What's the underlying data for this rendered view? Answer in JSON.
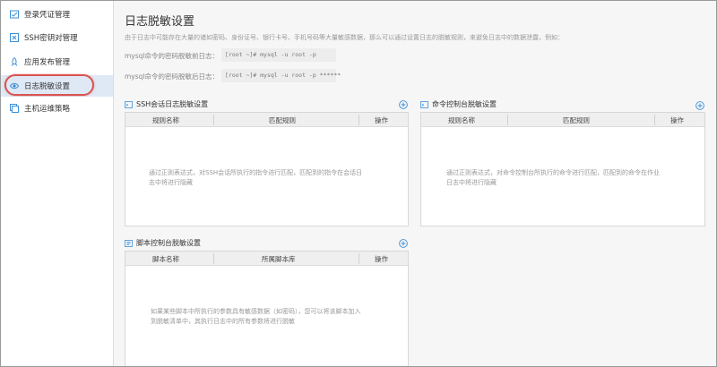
{
  "sidebar": {
    "items": [
      {
        "label": "登录凭证管理",
        "icon": "credential-icon"
      },
      {
        "label": "SSH密钥对管理",
        "icon": "key-pair-icon"
      },
      {
        "label": "应用发布管理",
        "icon": "rocket-icon"
      },
      {
        "label": "日志脱敏设置",
        "icon": "eye-icon"
      },
      {
        "label": "主机运维策略",
        "icon": "policy-icon"
      }
    ]
  },
  "main": {
    "title": "日志脱敏设置",
    "description": "由于日志中可能存在大量的诸如密码、身份证号、银行卡号、手机号码等大量敏感数据，那么可以通过设置日志的脱敏规则，来避免日志中的数据泄露，例如：",
    "examples": [
      {
        "label": "mysql命令的密码脱敏前日志：",
        "code": "[root ~]# mysql -u root -p"
      },
      {
        "label": "mysql命令的密码脱敏后日志：",
        "code": "[root ~]# mysql -u root -p ******"
      }
    ]
  },
  "panels": {
    "ssh": {
      "title": "SSH会话日志脱敏设置",
      "columns": [
        "规则名称",
        "匹配规则",
        "操作"
      ],
      "empty_line1": "通过正则表达式，对SSH会话所执行的指令进行匹配，匹配到的指令在会话日",
      "empty_line2": "志中将进行隐藏"
    },
    "console": {
      "title": "命令控制台脱敏设置",
      "columns": [
        "规则名称",
        "匹配规则",
        "操作"
      ],
      "empty_line1": "通过正则表达式，对命令控制台所执行的命令进行匹配，匹配到的命令在作业",
      "empty_line2": "日志中将进行隐藏"
    },
    "script": {
      "title": "脚本控制台脱敏设置",
      "columns": [
        "脚本名称",
        "所属脚本库",
        "操作"
      ],
      "empty_line1": "如果某些脚本中所执行的参数具有敏感数据（如密码），您可以将该脚本加入",
      "empty_line2": "到脱敏清单中，其执行日志中的所有参数将进行脱敏"
    }
  },
  "colors": {
    "accent": "#3b8fd8",
    "highlight": "#d9534f",
    "active_bg": "#dfe9f5"
  }
}
